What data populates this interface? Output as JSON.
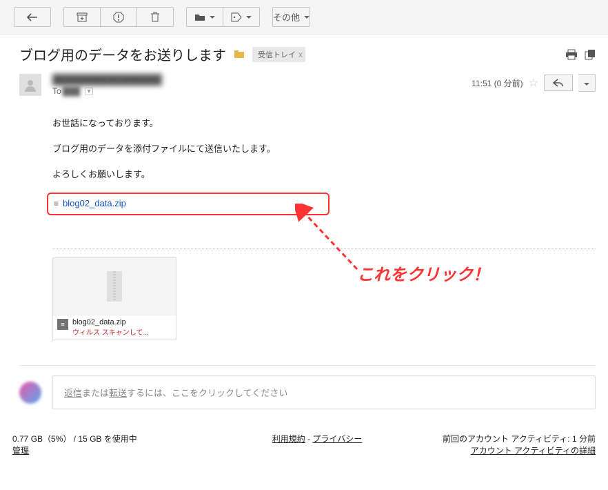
{
  "toolbar": {
    "more_label": "その他"
  },
  "subject": {
    "text": "ブログ用のデータをお送りします",
    "label": "受信トレイ",
    "label_close": "x"
  },
  "message": {
    "sender": "████████████████",
    "to_prefix": "To",
    "to_name": "███",
    "timestamp": "11:51 (0 分前)",
    "body": [
      "お世話になっております。",
      "ブログ用のデータを添付ファイルにて送信いたします。",
      "よろしくお願いします。"
    ],
    "attachment_link": "blog02_data.zip"
  },
  "annotation": {
    "text": "これをクリック！"
  },
  "attachment_card": {
    "filename": "blog02_data.zip",
    "virus_status": "ウィルス スキャンして..."
  },
  "reply_prompt": {
    "reply_word": "返信",
    "mid": "または",
    "forward_word": "転送",
    "suffix": "するには、ここをクリックしてください"
  },
  "footer": {
    "storage_used": "0.77 GB（5%）",
    "storage_sep": " / ",
    "storage_total": "15 GB を使用中",
    "manage": "管理",
    "terms": "利用規約",
    "dash": " - ",
    "privacy": "プライバシー",
    "activity_prefix": "前回のアカウント アクティビティ: ",
    "activity_time": "1 分前",
    "activity_link": "アカウント アクティビティの詳細"
  }
}
